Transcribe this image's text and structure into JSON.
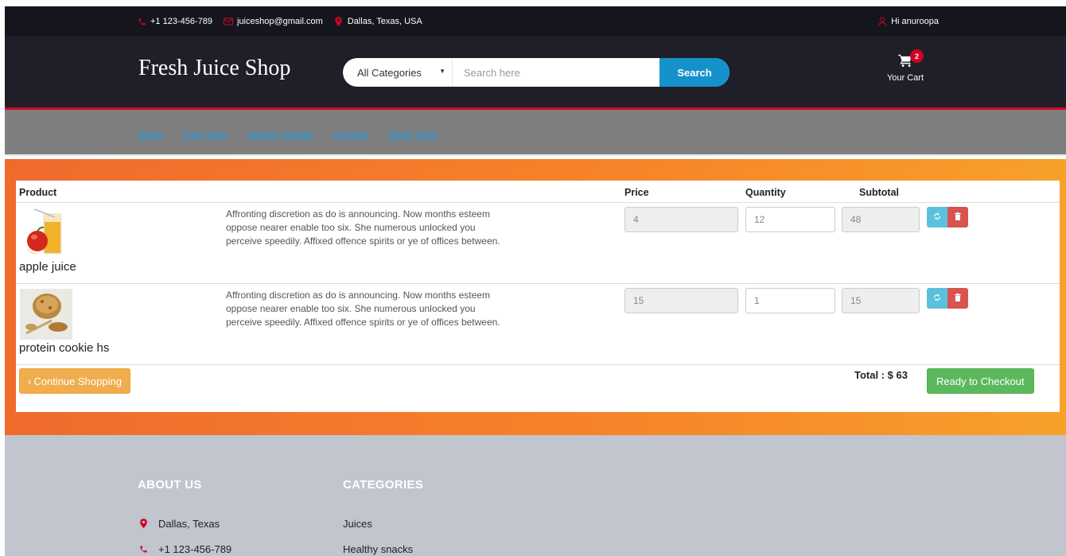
{
  "topbar": {
    "phone": "+1 123-456-789",
    "email": "juiceshop@gmail.com",
    "location": "Dallas, Texas, USA",
    "greeting": "Hi anuroopa"
  },
  "header": {
    "logo": "Fresh Juice Shop",
    "category_selected": "All Categories",
    "search_placeholder": "Search here",
    "search_label": "Search",
    "cart_count": "2",
    "cart_label": "Your Cart"
  },
  "nav": {
    "items": [
      "Home",
      "Fruit Juice",
      "Healthy Snacks",
      "Combos",
      "Other Juice"
    ]
  },
  "cart_table": {
    "headers": {
      "product": "Product",
      "price": "Price",
      "quantity": "Quantity",
      "subtotal": "Subtotal"
    },
    "rows": [
      {
        "name": "apple juice",
        "description": "Affronting discretion as do is announcing. Now months esteem oppose nearer enable too six. She numerous unlocked you perceive speedily. Affixed offence spirits or ye of offices between.",
        "price": "4",
        "quantity": "12",
        "subtotal": "48"
      },
      {
        "name": "protein cookie hs",
        "description": "Affronting discretion as do is announcing. Now months esteem oppose nearer enable too six. She numerous unlocked you perceive speedily. Affixed offence spirits or ye of offices between.",
        "price": "15",
        "quantity": "1",
        "subtotal": "15"
      }
    ],
    "continue_label": "Continue Shopping",
    "total_label": "Total : $ 63",
    "checkout_label": "Ready to Checkout"
  },
  "footer": {
    "about_title": "ABOUT US",
    "about_items": [
      "Dallas, Texas",
      "+1 123-456-789"
    ],
    "categories_title": "CATEGORIES",
    "categories_items": [
      "Juices",
      "Healthy snacks"
    ]
  },
  "colors": {
    "accent_red": "#d10024",
    "search_blue": "#1591cc",
    "nav_link": "#1a9be8",
    "orange": "#f6852a",
    "success": "#5cb85c",
    "warning": "#f0ad4e",
    "info": "#5bc0de",
    "danger": "#d9534f"
  }
}
